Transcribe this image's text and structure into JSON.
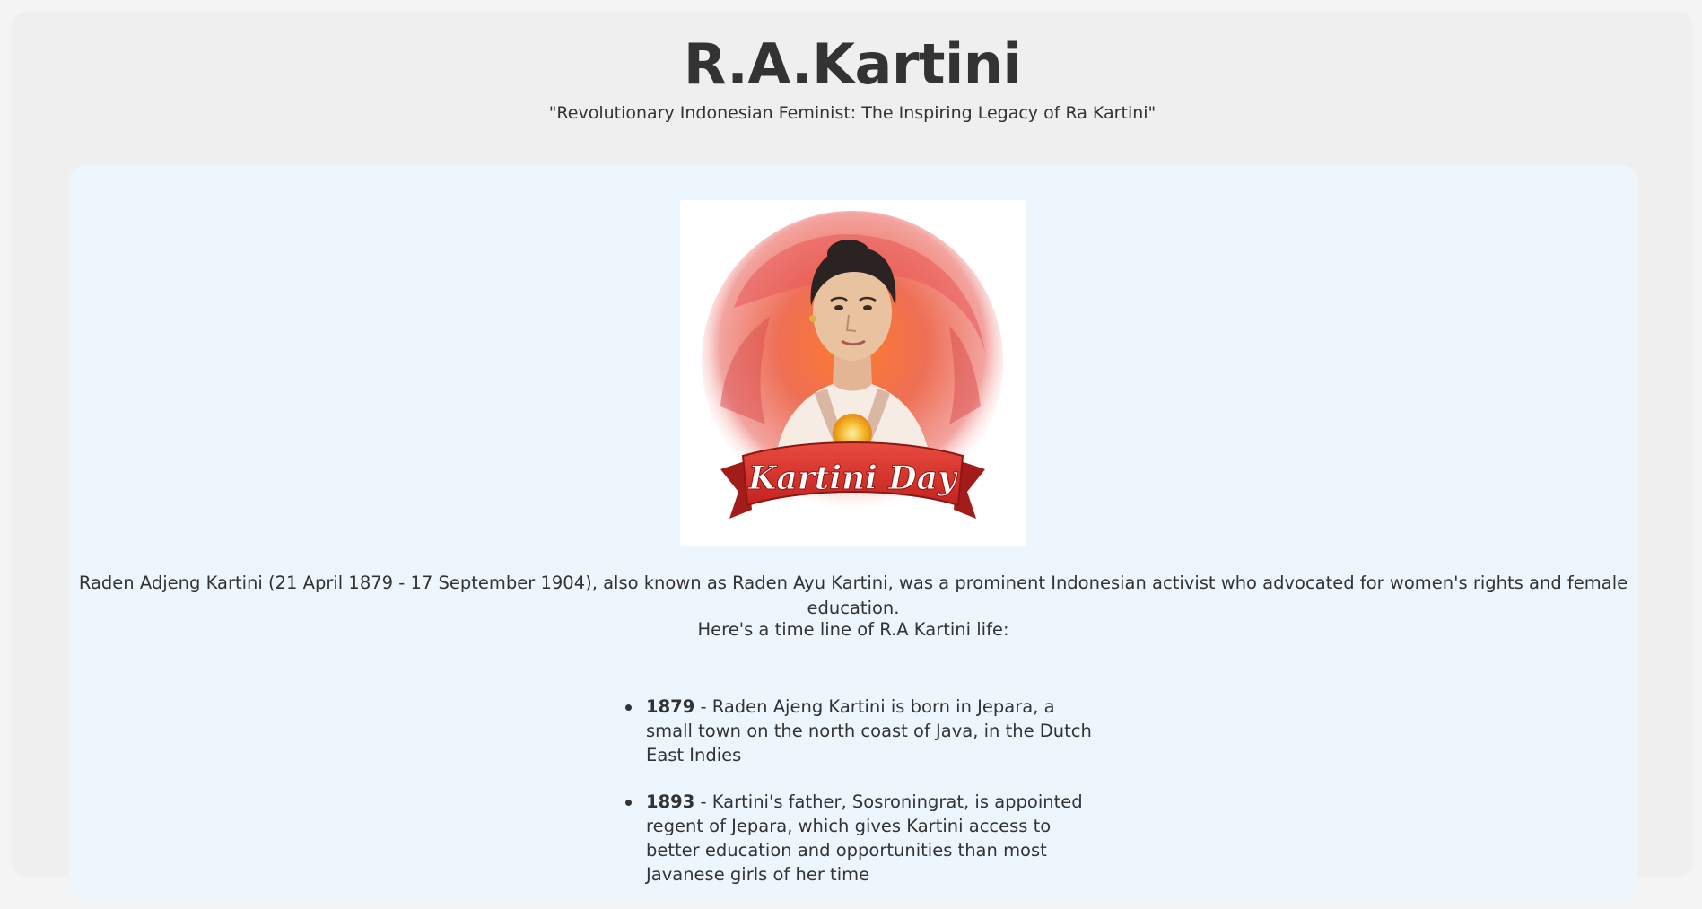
{
  "header": {
    "title": "R.A.Kartini",
    "subtitle": "\"Revolutionary Indonesian Feminist: The Inspiring Legacy of Ra Kartini\""
  },
  "portrait": {
    "banner_text": "Kartini Day",
    "colors": {
      "banner": "#d8342f",
      "splash": "#e8705a",
      "skin": "#e9c2a0",
      "hair": "#2b2321"
    }
  },
  "main": {
    "intro": "Raden Adjeng Kartini (21 April 1879 - 17 September 1904), also known as Raden Ayu Kartini, was a prominent Indonesian activist who advocated for women's rights and female education.",
    "timeline_intro": "Here's a time line of R.A Kartini life:",
    "timeline": [
      {
        "year": "1879",
        "text": " - Raden Ajeng Kartini is born in Jepara, a small town on the north coast of Java, in the Dutch East Indies"
      },
      {
        "year": "1893",
        "text": " - Kartini's father, Sosroningrat, is appointed regent of Jepara, which gives Kartini access to better education and opportunities than most Javanese girls of her time"
      }
    ]
  },
  "colors": {
    "page_bg": "#efefef",
    "card_bg": "#eef6fd",
    "text": "#333333"
  }
}
